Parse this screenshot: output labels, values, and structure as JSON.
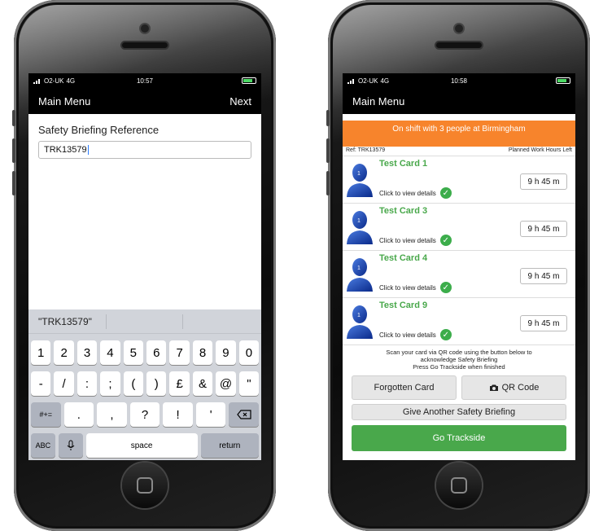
{
  "left": {
    "status": {
      "carrier": "O2-UK",
      "network": "4G",
      "time": "10:57"
    },
    "nav": {
      "back": "Main Menu",
      "next": "Next"
    },
    "form": {
      "label": "Safety Briefing Reference",
      "value": "TRK13579"
    },
    "keyboard": {
      "suggestion": "\"TRK13579\"",
      "row1": [
        "1",
        "2",
        "3",
        "4",
        "5",
        "6",
        "7",
        "8",
        "9",
        "0"
      ],
      "row2": [
        "-",
        "/",
        ":",
        ";",
        "(",
        ")",
        "£",
        "&",
        "@",
        "\""
      ],
      "row3_left": "#+=",
      "row3": [
        ".",
        ",",
        "?",
        "!",
        "'"
      ],
      "abc": "ABC",
      "space": "space",
      "return": "return"
    }
  },
  "right": {
    "status": {
      "carrier": "O2-UK",
      "network": "4G",
      "time": "10:58"
    },
    "nav": {
      "back": "Main Menu"
    },
    "banner": "On shift with 3 people at Birmingham",
    "ref": "Ref: TRK13579",
    "hours_header": "Planned Work Hours Left",
    "cards": [
      {
        "title": "Test Card 1",
        "details": "Click to view details",
        "hours": "9 h 45 m"
      },
      {
        "title": "Test Card 3",
        "details": "Click to view details",
        "hours": "9 h 45 m"
      },
      {
        "title": "Test Card 4",
        "details": "Click to view details",
        "hours": "9 h 45 m"
      },
      {
        "title": "Test Card 9",
        "details": "Click to view details",
        "hours": "9 h 45 m"
      }
    ],
    "scan_msg_1": "Scan your card via QR code using the button below to",
    "scan_msg_2": "acknowledge Safety Briefing",
    "scan_msg_3": "Press Go Trackside when finished",
    "forgotten": "Forgotten Card",
    "qr": "QR Code",
    "give_another": "Give Another Safety Briefing",
    "go_trackside": "Go Trackside"
  },
  "colors": {
    "accent_orange": "#f7842c",
    "accent_green": "#49a84b",
    "check_green": "#3cad4b"
  }
}
